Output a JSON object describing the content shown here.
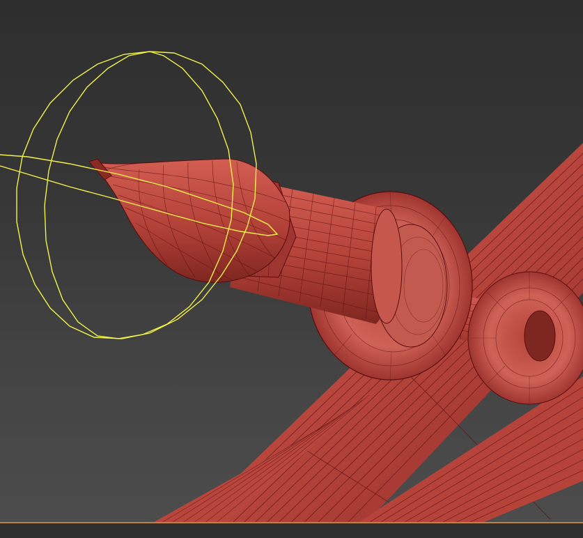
{
  "viewport": {
    "label": "",
    "background_top": "#2e2e2e",
    "background_bottom": "#4d4d4d"
  },
  "model": {
    "name": "",
    "material_color": "#b8463d",
    "wire_color": "#5a0d0d",
    "shadow_color": "#7a2520"
  },
  "gizmo": {
    "type": "rotate-gizmo",
    "color": "#f2f24a"
  },
  "grid": {
    "horizon_color": "#b9843f"
  }
}
